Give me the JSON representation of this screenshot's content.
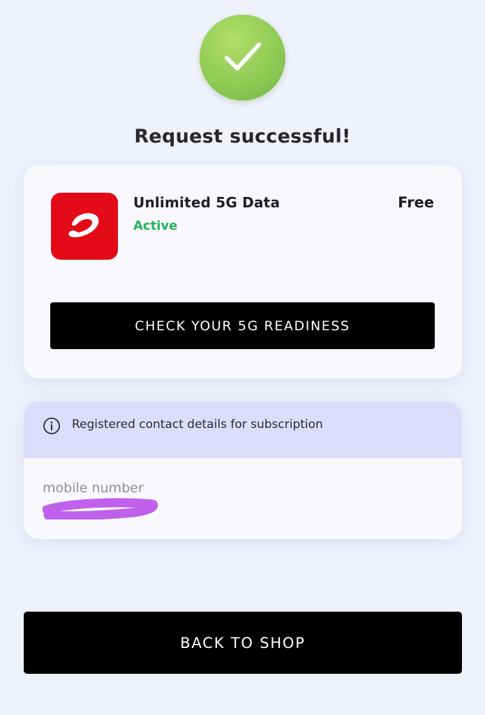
{
  "status": {
    "icon": "checkmark-circle-icon",
    "title": "Request successful!",
    "accent_color": "#8fcb55"
  },
  "plan": {
    "logo_icon": "airtel-logo-icon",
    "logo_color": "#e30b17",
    "name": "Unlimited 5G Data",
    "status": "Active",
    "status_color": "#22b25c",
    "price": "Free",
    "cta_label": "CHECK YOUR 5G READINESS"
  },
  "contact": {
    "info_icon": "info-icon",
    "heading": "Registered contact details for subscription",
    "header_color": "#dcdcfb",
    "field_label": "mobile number",
    "redaction_color": "#c061ec"
  },
  "footer": {
    "shop_label": "BACK TO SHOP"
  }
}
